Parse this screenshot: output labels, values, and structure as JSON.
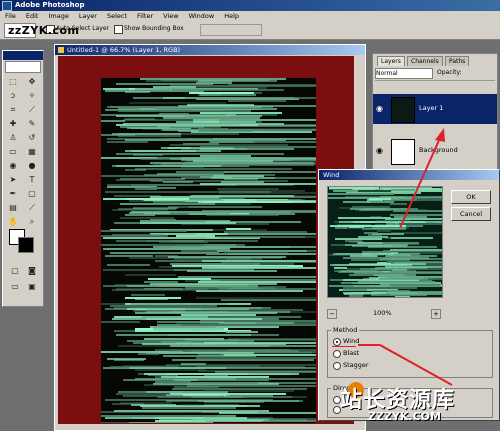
{
  "window": {
    "title": "Adobe Photoshop"
  },
  "menu": [
    "File",
    "Edit",
    "Image",
    "Layer",
    "Select",
    "Filter",
    "View",
    "Window",
    "Help"
  ],
  "options": {
    "checkbox1": "Auto Select Layer",
    "checkbox2": "Show Bounding Box"
  },
  "watermark_top": "zzZYK.com",
  "document": {
    "title": "Untitled-1 @ 66.7% (Layer 1, RGB)",
    "canvas_bg": "#7b0f10"
  },
  "layers_palette": {
    "tabs": [
      "Layers",
      "Channels",
      "Paths"
    ],
    "blend_mode": "Normal",
    "opacity_label": "Opacity:",
    "layers": [
      {
        "name": "Layer 1",
        "selected": true
      },
      {
        "name": "Background",
        "selected": false
      }
    ]
  },
  "wind_dialog": {
    "title": "Wind",
    "ok_label": "OK",
    "cancel_label": "Cancel",
    "zoom_minus": "−",
    "zoom_plus": "+",
    "zoom_value": "100%",
    "method_label": "Method",
    "methods": [
      {
        "label": "Wind",
        "checked": true
      },
      {
        "label": "Blast",
        "checked": false
      },
      {
        "label": "Stagger",
        "checked": false
      }
    ],
    "direction_label": "Direction"
  },
  "watermark": {
    "chinese": "站长资源库",
    "english": "ZZZYK.COM"
  },
  "colors": {
    "accent": "#0a246a",
    "arrow": "#e0202a"
  }
}
